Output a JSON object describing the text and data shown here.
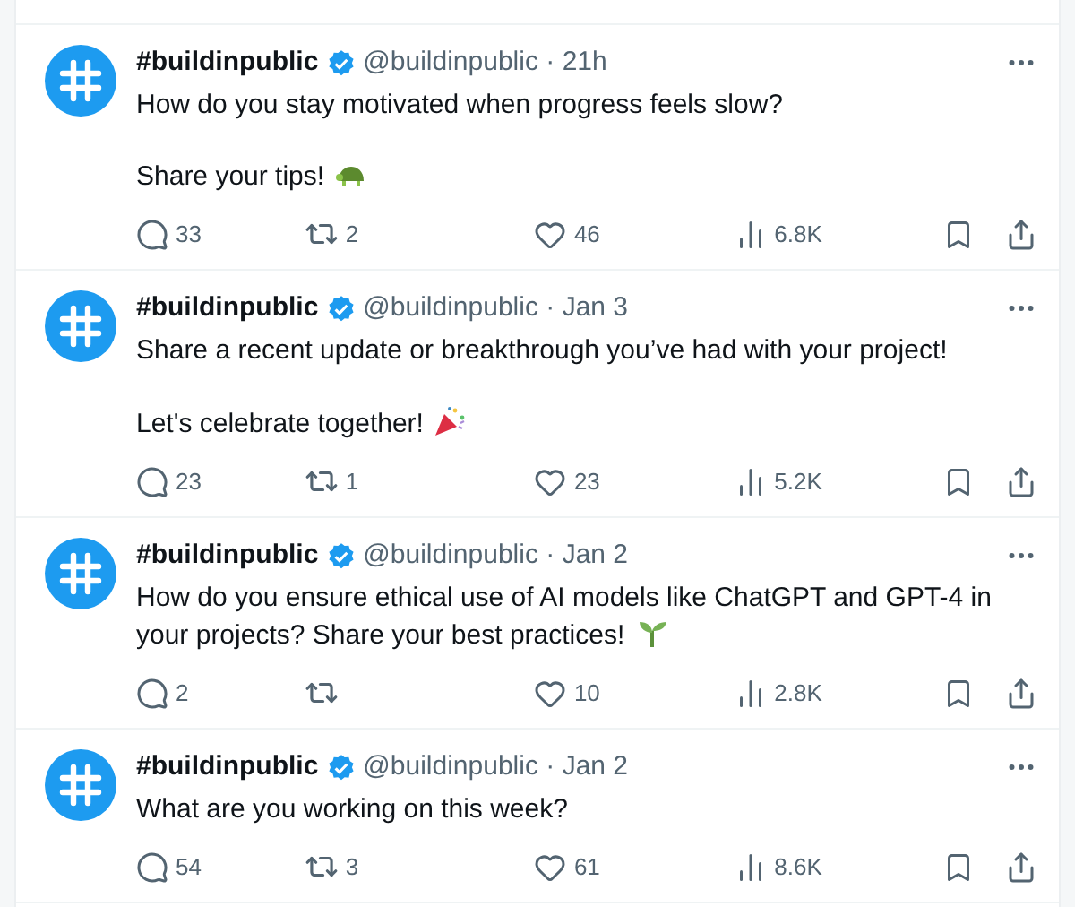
{
  "tweets": [
    {
      "name": "#buildinpublic",
      "verified": true,
      "handle": "@buildinpublic",
      "separator": "·",
      "time": "21h",
      "paragraphs": [
        "How do you stay motivated when progress feels slow?",
        "Share your tips!"
      ],
      "emoji": {
        "kind": "turtle"
      },
      "replies": "33",
      "reposts": "2",
      "likes": "46",
      "views": "6.8K"
    },
    {
      "name": "#buildinpublic",
      "verified": true,
      "handle": "@buildinpublic",
      "separator": "·",
      "time": "Jan 3",
      "paragraphs": [
        "Share a recent update or breakthrough you’ve had with your project!",
        "Let's celebrate together!"
      ],
      "emoji": {
        "kind": "party-popper"
      },
      "replies": "23",
      "reposts": "1",
      "likes": "23",
      "views": "5.2K"
    },
    {
      "name": "#buildinpublic",
      "verified": true,
      "handle": "@buildinpublic",
      "separator": "·",
      "time": "Jan 2",
      "paragraphs": [
        "How do you ensure ethical use of AI models like ChatGPT and GPT-4 in your projects? Share your best practices!"
      ],
      "emoji": {
        "kind": "seedling"
      },
      "replies": "2",
      "likes": "10",
      "views": "2.8K"
    },
    {
      "name": "#buildinpublic",
      "verified": true,
      "handle": "@buildinpublic",
      "separator": "·",
      "time": "Jan 2",
      "paragraphs": [
        "What are you working on this week?"
      ],
      "replies": "54",
      "reposts": "3",
      "likes": "61",
      "views": "8.6K"
    }
  ]
}
